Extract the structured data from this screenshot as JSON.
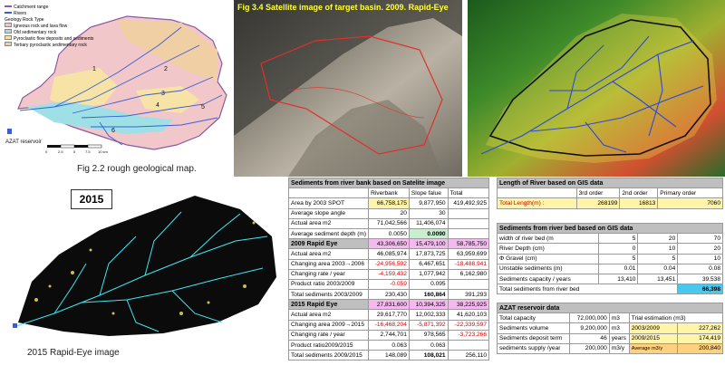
{
  "geo_map": {
    "legend": [
      "Catchment range",
      "Rivers"
    ],
    "legend_title": "Geology Rock Type",
    "rock_types": [
      {
        "label": "Igneous rock and lava flow",
        "color": "#f2c7c9"
      },
      {
        "label": "Old sedimentary rock",
        "color": "#9ee0e6"
      },
      {
        "label": "Pyroclastic flow deposits and sediments",
        "color": "#f7e3a6"
      },
      {
        "label": "Tertiary pyroclastic sedimentary rock",
        "color": "#f1cfa5"
      }
    ],
    "river_numbers": [
      "1",
      "2",
      "3",
      "4",
      "5",
      "6"
    ],
    "reservoir_label": "AZAT reservoir",
    "scale_ticks": [
      "0",
      "2.5",
      "5",
      "7.5",
      "10 km"
    ],
    "caption": "Fig 2.2 rough geological map."
  },
  "satellite": {
    "title": "Fig 3.4 Satellite image of target basin. 2009. Rapid-Eye"
  },
  "rapid_eye": {
    "year_label": "2015",
    "caption": "2015 Rapid-Eye image"
  },
  "satellite_table": {
    "title": "Sediments from river bank based on Satelite image",
    "columns": [
      "",
      "Riverbank",
      "Slope falue",
      "Total"
    ],
    "rows": [
      [
        "Area by 2003 SPOT",
        "66,758,175",
        "9,877,950",
        "419,492,925"
      ],
      [
        "Average slope angle",
        "20",
        "30",
        ""
      ],
      [
        "Actual area  m2",
        "71,042,566",
        "11,406,074",
        ""
      ],
      [
        "Average sediment depth (m)",
        "0.0050",
        "0.0090",
        ""
      ],
      [
        "2009 Rapid Eye",
        "43,306,650",
        "15,479,100",
        "58,785,750"
      ],
      [
        "Actual area  m2",
        "46,085,974",
        "17,873,725",
        "63,959,699"
      ],
      [
        "Changing area 2003→2006",
        "-24,956,592",
        "6,467,651",
        "-18,488,941"
      ],
      [
        "Changing rate / year",
        "-4,159,432",
        "1,077,942",
        "6,162,980"
      ],
      [
        "Product ratio 2003/2009",
        "-0.059",
        "0.095",
        ""
      ],
      [
        "Total sediments 2003/2009",
        "230,430",
        "160,864",
        "391,293"
      ],
      [
        "2015 Rapid Eye",
        "27,831,600",
        "10,394,325",
        "38,225,925"
      ],
      [
        "Actual area  m2",
        "29,617,770",
        "12,002,333",
        "41,620,103"
      ],
      [
        "Changing area 2009→2015",
        "-16,468,204",
        "-5,871,392",
        "-22,339,597"
      ],
      [
        "Changing rate / year",
        "2,744,701",
        "978,565",
        "-3,723,266"
      ],
      [
        "Product ratio2009/2015",
        "0.063",
        "0.063",
        ""
      ],
      [
        "Total sediments 2009/2015",
        "148,089",
        "108,021",
        "256,110"
      ]
    ]
  },
  "length_table": {
    "title": "Length of River based on GIS data",
    "columns": [
      "",
      "3rd order",
      "2nd order",
      "Primary order"
    ],
    "row_label": "Total Length(m) :",
    "values": [
      "268199",
      "16813",
      "7060"
    ]
  },
  "bed_table": {
    "title": "Sediments from river bed based on GIS data",
    "rows": [
      [
        "width of river bed (m",
        "5",
        "20",
        "70"
      ],
      [
        "River Depth (cm)",
        "0",
        "10",
        "20"
      ],
      [
        "Φ Gravel (cm)",
        "5",
        "5",
        "10"
      ],
      [
        "Unstable sediments (m)",
        "0.01",
        "0.04",
        "0.08"
      ],
      [
        "Sediments capacity / years",
        "13,410",
        "13,451",
        "39,538"
      ]
    ],
    "total_label": "Total sediments from river bed",
    "total_value": "66,398"
  },
  "azat_table": {
    "title": "AZAT reservoir data",
    "rows": [
      [
        "Total capacity",
        "72,000,000",
        "m3",
        "Trial estimation (m3)",
        ""
      ],
      [
        "Sediments volume",
        "9,200,000",
        "m3",
        "2003/2009",
        "227,262"
      ],
      [
        "Sediments deposit term",
        "46",
        "years",
        "2009/2015",
        "174,419"
      ],
      [
        "sediments supply /year",
        "200,000",
        "m3/y",
        "Average m3/y",
        "200,840"
      ]
    ]
  },
  "colors": {
    "river_blue": "#3a5fd0",
    "cyan_highlight": "#48c8ee",
    "pink_highlight": "#f5b8ef",
    "yellow_highlight": "#fff4a8"
  }
}
